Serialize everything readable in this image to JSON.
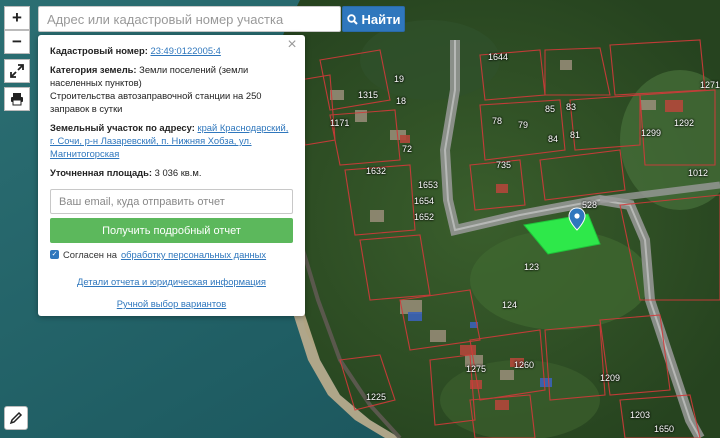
{
  "search": {
    "placeholder": "Адрес или кадастровый номер участка",
    "button_label": "Найти"
  },
  "toolbar": {
    "zoom_in_label": "+",
    "zoom_out_label": "−"
  },
  "popup": {
    "cadastral_label": "Кадастровый номер:",
    "cadastral_value": "23:49:0122005:4",
    "category_label": "Категория земель:",
    "category_value": "Земли поселений (земли населенных пунктов)",
    "purpose_value": "Строительства автозаправочной станции на 250 заправок в сутки",
    "address_label": "Земельный участок по адресу:",
    "address_value": "край Краснодарский, г. Сочи, р-н Лазаревский, п. Нижняя Хобза, ул. Магнитогорская",
    "area_label": "Уточненная площадь:",
    "area_value": "3 036 кв.м.",
    "email_placeholder": "Ваш email, куда отправить отчет",
    "report_button_label": "Получить подробный отчет",
    "consent_prefix": "Согласен на",
    "consent_link": "обработку персональных данных",
    "details_link": "Детали отчета и юридическая информация",
    "manual_link": "Ручной выбор вариантов",
    "close_label": "×"
  },
  "map": {
    "highlight_color": "#2ee84a",
    "marker_color": "#2f77bd",
    "plot_numbers": [
      "1644",
      "1315",
      "1171",
      "19",
      "18",
      "72",
      "78",
      "79",
      "85",
      "83",
      "84",
      "81",
      "1299",
      "1292",
      "1271",
      "1012",
      "735",
      "1653",
      "1654",
      "1632",
      "1652",
      "528",
      "123",
      "124",
      "1209",
      "1225",
      "1275",
      "1260",
      "1203",
      "1650"
    ]
  },
  "colors": {
    "accent": "#2f77bd",
    "success": "#5cb85c"
  }
}
